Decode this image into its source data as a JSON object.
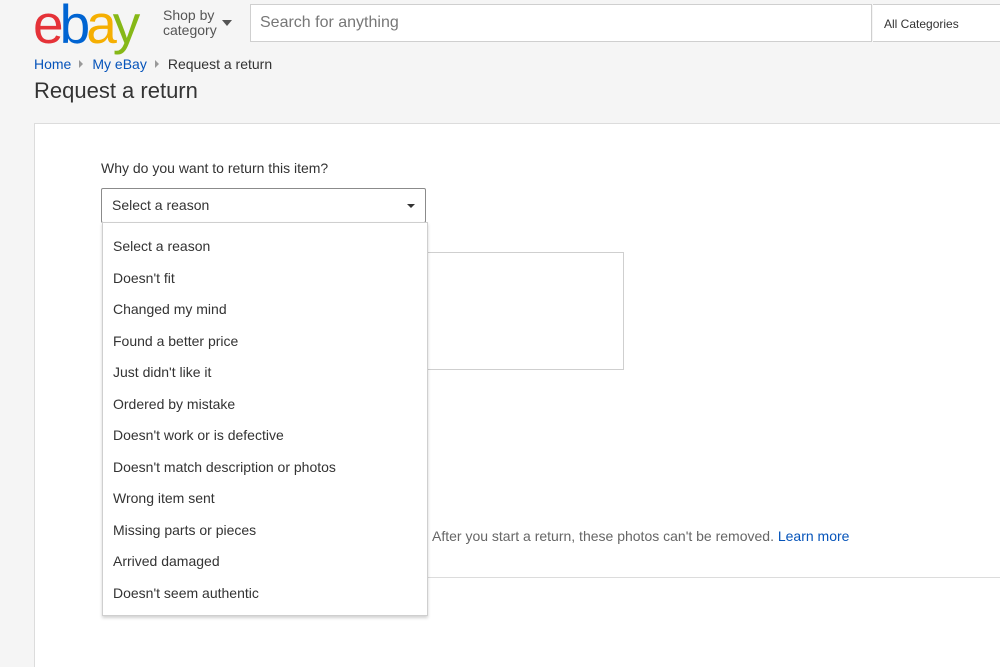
{
  "header": {
    "logo": {
      "letters": [
        "e",
        "b",
        "a",
        "y"
      ],
      "colors": [
        "#e53238",
        "#0064d2",
        "#f5af02",
        "#86b817"
      ]
    },
    "shop_by_line1": "Shop by",
    "shop_by_line2": "category",
    "search_placeholder": "Search for anything",
    "category_select": "All Categories"
  },
  "breadcrumb": {
    "home": "Home",
    "my_ebay": "My eBay",
    "current": "Request a return"
  },
  "page_title": "Request a return",
  "form": {
    "question": "Why do you want to return this item?",
    "reason_selected": "Select a reason",
    "reason_options": [
      "Select a reason",
      "Doesn't fit",
      "Changed my mind",
      "Found a better price",
      "Just didn't like it",
      "Ordered by mistake",
      "Doesn't work or is defective",
      "Doesn't match description or photos",
      "Wrong item sent",
      "Missing parts or pieces",
      "Arrived damaged",
      "Doesn't seem authentic"
    ],
    "photo_note": "After you start a return, these photos can't be removed.",
    "learn_more": "Learn more"
  },
  "colors": {
    "link": "#0654ba",
    "background": "#f5f5f5"
  }
}
